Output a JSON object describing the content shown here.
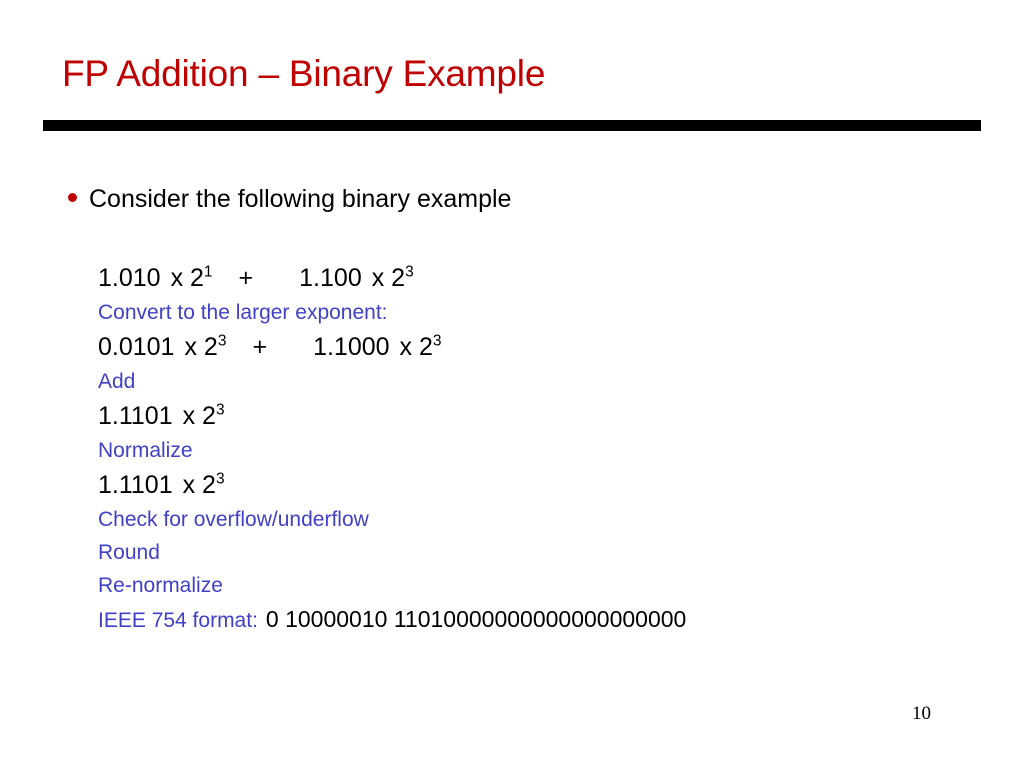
{
  "slide": {
    "title": "FP Addition – Binary Example",
    "page_number": "10",
    "colors": {
      "title_red": "#C00000",
      "bullet_red": "#C00000",
      "annotation_blue": "#4040C8",
      "body_black": "#000000",
      "rule_black": "#000000",
      "background": "#FFFFFF"
    },
    "bullet": {
      "marker": "bullet-dot",
      "text": "Consider the following binary example"
    },
    "steps": [
      {
        "kind": "equation",
        "parts": {
          "lhs_mantissa": "1.010",
          "lhs_times": "x 2",
          "lhs_exponent": "1",
          "operator": "+",
          "rhs_mantissa": "1.100",
          "rhs_times": "x 2",
          "rhs_exponent": "3"
        },
        "plain": "1.010  x 2^1   +    1.100 x 2^3"
      },
      {
        "kind": "annotation",
        "text": "Convert to the larger exponent:"
      },
      {
        "kind": "equation",
        "parts": {
          "lhs_mantissa": "0.0101",
          "lhs_times": "x 2",
          "lhs_exponent": "3",
          "operator": "+",
          "rhs_mantissa": "1.1000",
          "rhs_times": "x 2",
          "rhs_exponent": "3"
        },
        "plain": "0.0101  x 2^3   +    1.1000 x 2^3"
      },
      {
        "kind": "annotation",
        "text": "Add"
      },
      {
        "kind": "equation_single",
        "parts": {
          "mantissa": "1.1101",
          "times": "x 2",
          "exponent": "3"
        },
        "plain": "1.1101  x 2^3"
      },
      {
        "kind": "annotation",
        "text": "Normalize"
      },
      {
        "kind": "equation_single",
        "parts": {
          "mantissa": "1.1101",
          "times": "x 2",
          "exponent": "3"
        },
        "plain": "1.1101  x 2^3"
      },
      {
        "kind": "annotation",
        "text": "Check for overflow/underflow"
      },
      {
        "kind": "annotation",
        "text": "Round"
      },
      {
        "kind": "annotation",
        "text": "Re-normalize"
      },
      {
        "kind": "annotation_with_value",
        "label": "IEEE 754 format:",
        "value": "0 10000010 11010000000000000000000"
      }
    ]
  }
}
